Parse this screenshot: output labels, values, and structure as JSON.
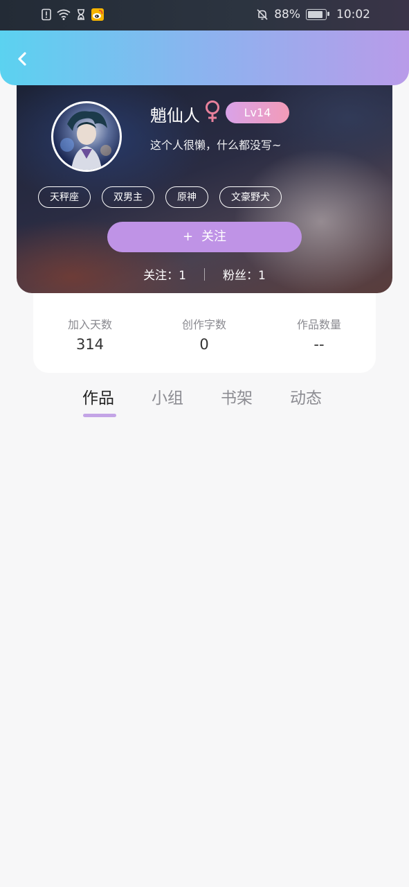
{
  "status_bar": {
    "battery": "88%",
    "time": "10:02",
    "battery_level": 0.88,
    "icons_left": [
      "sim-alert-icon",
      "wifi-icon",
      "hourglass-icon",
      "weibo-icon"
    ],
    "icons_right": [
      "bell-muted-icon",
      "battery-icon"
    ]
  },
  "header": {
    "back_icon": "chevron-left-icon",
    "gradient_colors": [
      "#5bd2f0",
      "#b99be9"
    ]
  },
  "profile": {
    "username": "魈仙人",
    "gender_symbol": "♀",
    "level": "Lv14",
    "bio": "这个人很懒，什么都没写~",
    "tags": [
      "天秤座",
      "双男主",
      "原神",
      "文豪野犬"
    ],
    "follow_button": {
      "plus": "+",
      "label": "关注"
    },
    "following": "关注：1",
    "followers": "粉丝：1"
  },
  "info": {
    "items": [
      {
        "label": "加入天数",
        "value": "314"
      },
      {
        "label": "创作字数",
        "value": "0"
      },
      {
        "label": "作品数量",
        "value": "--"
      }
    ]
  },
  "tabs": {
    "items": [
      {
        "label": "作品",
        "active": true
      },
      {
        "label": "小组",
        "active": false
      },
      {
        "label": "书架",
        "active": false
      },
      {
        "label": "动态",
        "active": false
      }
    ],
    "indicator_color": "#c3a4e6"
  },
  "colors": {
    "accent": "#bf93e6",
    "gender_pink": "#e8819c",
    "level_gradient": [
      "#d9a2e8",
      "#f29bb7"
    ]
  }
}
